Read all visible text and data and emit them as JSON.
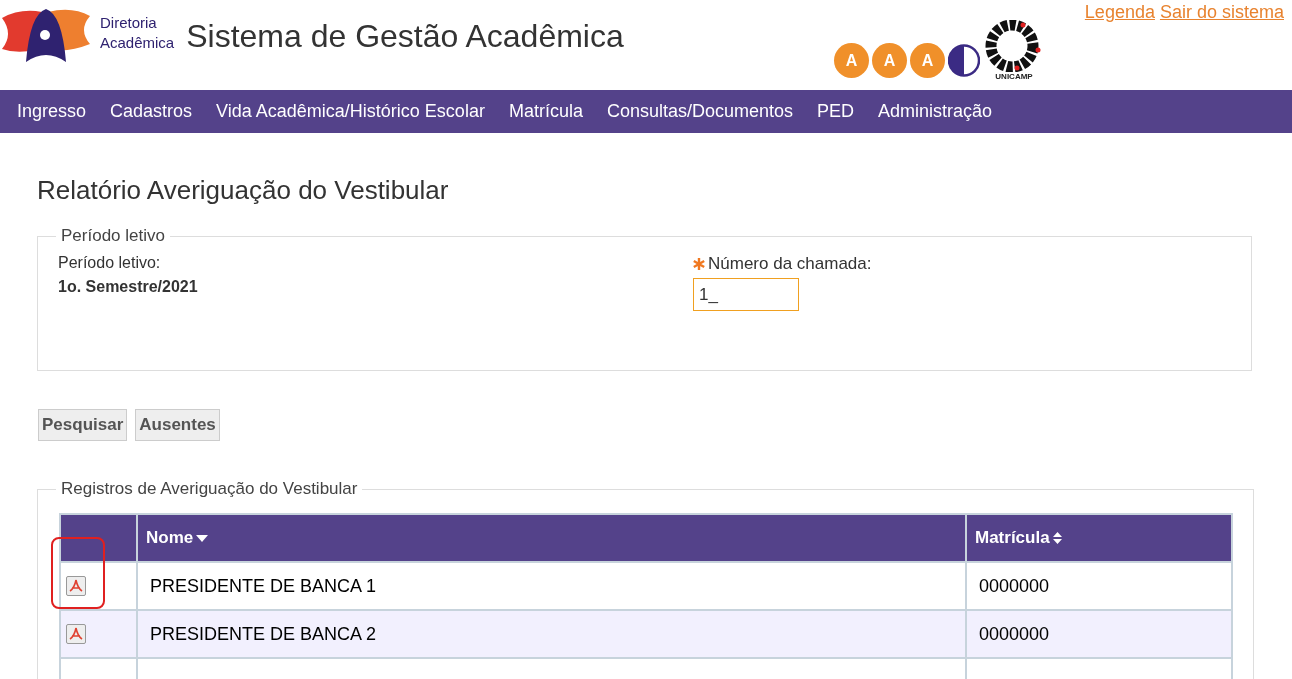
{
  "header": {
    "org_name": [
      "Diretoria",
      "Acadêmica"
    ],
    "title": "Sistema de Gestão Acadêmica",
    "accessibility_buttons": [
      "A",
      "A",
      "A"
    ],
    "university_logo_text": "UNICAMP",
    "links": [
      "Legenda",
      "Sair do sistema"
    ]
  },
  "menu": [
    "Ingresso",
    "Cadastros",
    "Vida Acadêmica/Histórico Escolar",
    "Matrícula",
    "Consultas/Documentos",
    "PED",
    "Administração"
  ],
  "page_title": "Relatório Averiguação do Vestibular",
  "period_section": {
    "legend": "Período letivo",
    "period_label": "Período letivo:",
    "period_value": "1o. Semestre/2021",
    "call_label": "Número da chamada:",
    "required": true,
    "call_value": "1_",
    "focused": true
  },
  "buttons": [
    "Pesquisar",
    "Ausentes"
  ],
  "records_section": {
    "legend": "Registros de Averiguação do Vestibular",
    "table": {
      "columns": [
        {
          "label": "Nome",
          "kind": "sorted"
        },
        {
          "label": "Matrícula",
          "kind": "sortable"
        }
      ],
      "rows": [
        {
          "name": "PRESIDENTE DE BANCA 1",
          "matricula": "0000000",
          "highlighted": true
        },
        {
          "name": "PRESIDENTE DE BANCA 2",
          "matricula": "0000000",
          "highlighted": false
        }
      ]
    }
  }
}
